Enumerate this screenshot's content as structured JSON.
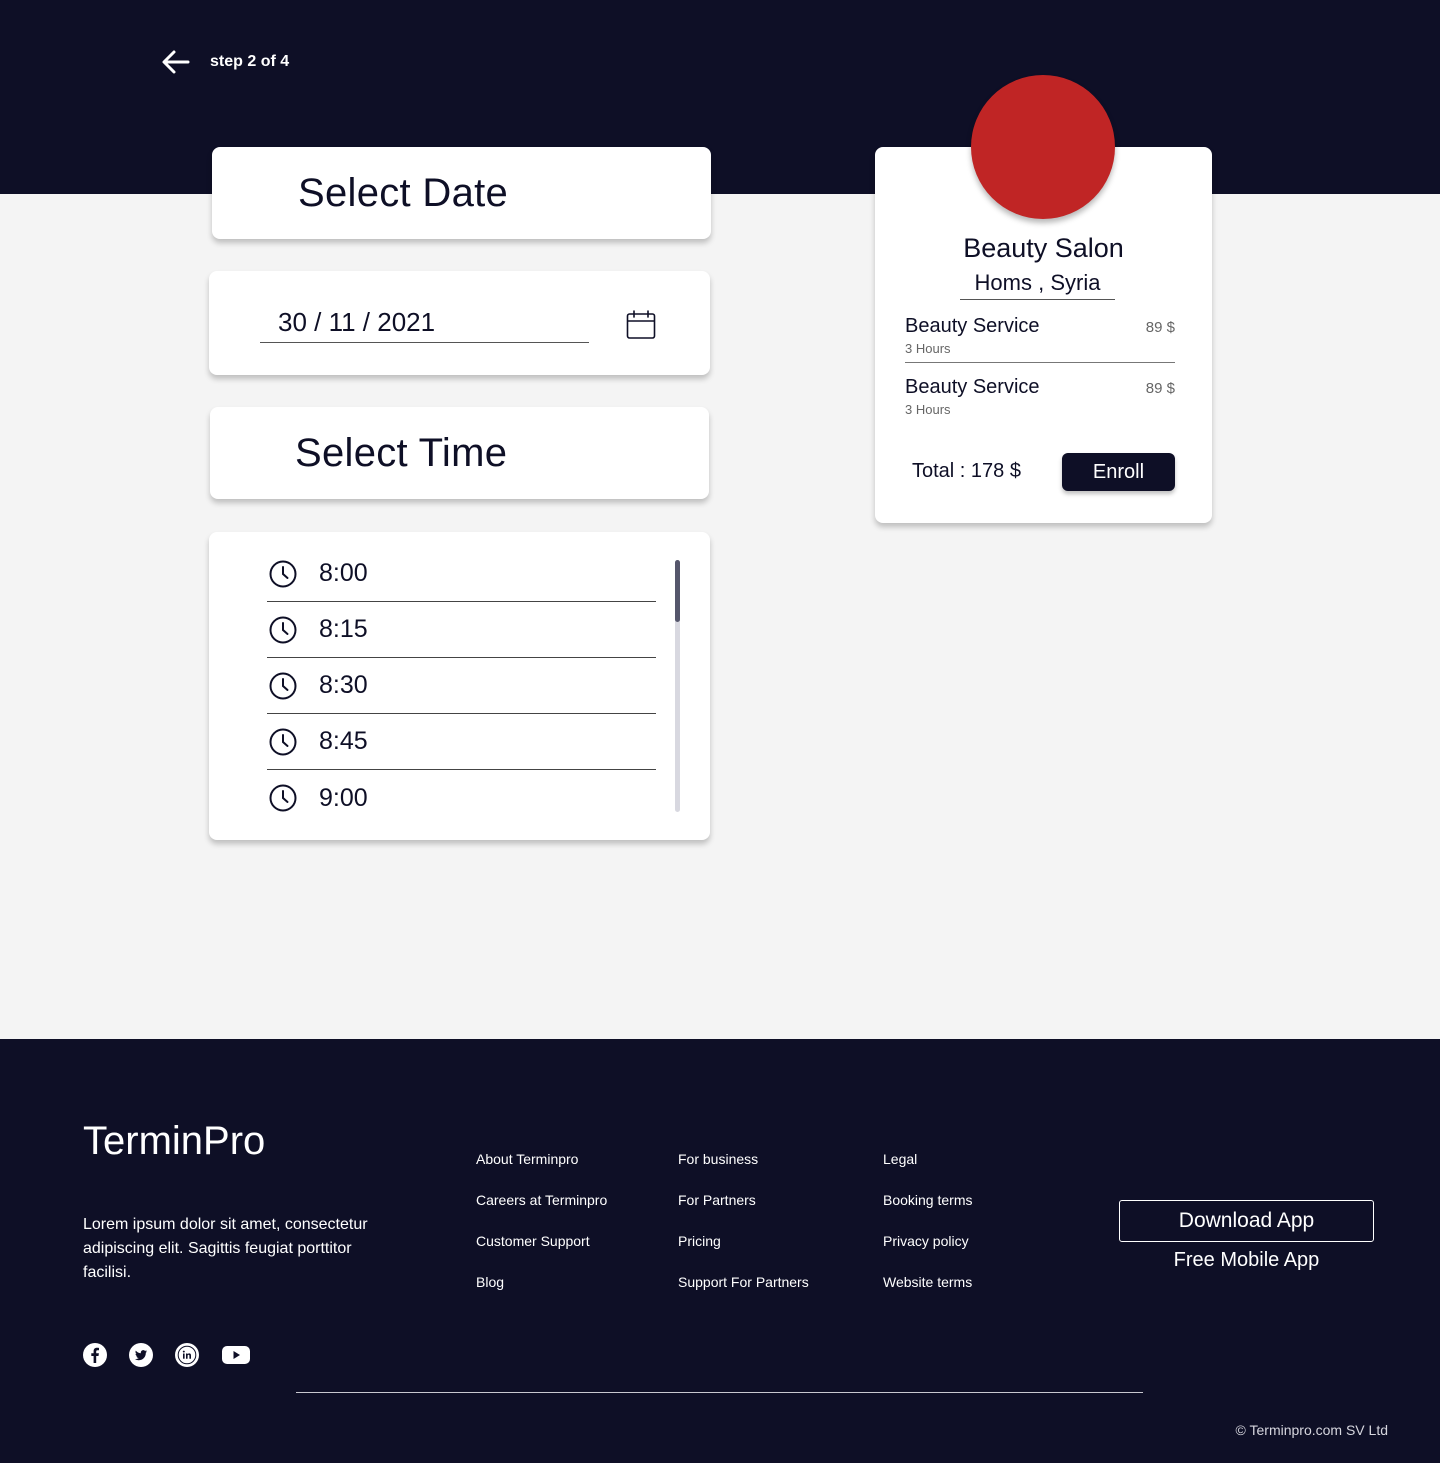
{
  "header": {
    "step_label": "step 2 of 4"
  },
  "date_section": {
    "title": "Select Date",
    "value": "30 / 11 / 2021"
  },
  "time_section": {
    "title": "Select Time",
    "slots": [
      "8:00",
      "8:15",
      "8:30",
      "8:45",
      "9:00"
    ]
  },
  "summary": {
    "salon_name": "Beauty Salon",
    "location": "Homs , Syria",
    "services": [
      {
        "name": "Beauty Service",
        "duration": "3 Hours",
        "price": "89 $"
      },
      {
        "name": "Beauty Service",
        "duration": "3 Hours",
        "price": "89 $"
      }
    ],
    "total_label": "Total :  178 $",
    "enroll_label": "Enroll",
    "avatar_color": "#c02525"
  },
  "footer": {
    "brand": "TerminPro",
    "tagline": "Lorem ipsum dolor sit amet, consectetur adipiscing elit. Sagittis feugiat porttitor facilisi.",
    "columns": [
      [
        "About Terminpro",
        "Careers at Terminpro",
        "Customer Support",
        "Blog"
      ],
      [
        "For business",
        "For Partners",
        "Pricing",
        "Support For Partners"
      ],
      [
        "Legal",
        "Booking terms",
        "Privacy policy",
        "Website terms"
      ]
    ],
    "download_label": "Download App",
    "download_sub": "Free Mobile App",
    "social": [
      "facebook-icon",
      "twitter-icon",
      "linkedin-icon",
      "youtube-icon"
    ],
    "copyright": "© Terminpro.com SV Ltd"
  },
  "colors": {
    "navy": "#0e0f26",
    "background": "#f4f4f4",
    "accent_red": "#c02525"
  }
}
